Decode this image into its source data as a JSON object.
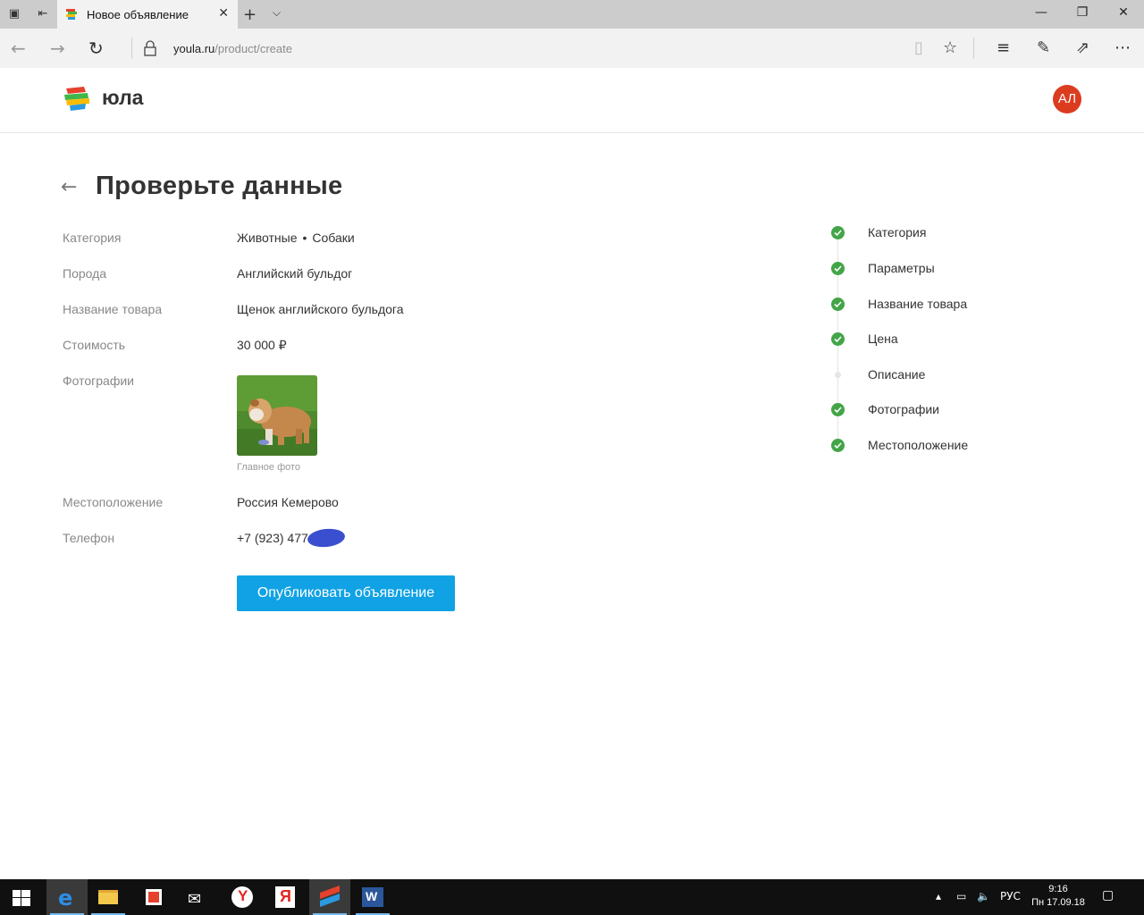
{
  "browser": {
    "tab_title": "Новое объявление",
    "url_host": "youla.ru",
    "url_path": "/product/create"
  },
  "site": {
    "logo_text": "юла",
    "avatar_initials": "АЛ"
  },
  "page": {
    "title": "Проверьте данные",
    "rows": {
      "category": {
        "label": "Категория",
        "value_main": "Животные",
        "value_sub": "Собаки"
      },
      "breed": {
        "label": "Порода",
        "value": "Английский бульдог"
      },
      "name": {
        "label": "Название товара",
        "value": "Щенок английского бульдога"
      },
      "price": {
        "label": "Стоимость",
        "value": "30 000 ₽"
      },
      "photos": {
        "label": "Фотографии",
        "caption": "Главное фото"
      },
      "location": {
        "label": "Местоположение",
        "value": "Россия Кемерово"
      },
      "phone": {
        "label": "Телефон",
        "value": "+7 (923) 477-"
      }
    },
    "publish_button": "Опубликовать объявление"
  },
  "steps": [
    {
      "label": "Категория",
      "done": true
    },
    {
      "label": "Параметры",
      "done": true
    },
    {
      "label": "Название товара",
      "done": true
    },
    {
      "label": "Цена",
      "done": true
    },
    {
      "label": "Описание",
      "done": false
    },
    {
      "label": "Фотографии",
      "done": true
    },
    {
      "label": "Местоположение",
      "done": true
    }
  ],
  "taskbar": {
    "language": "РУС",
    "time": "9:16",
    "date": "Пн 17.09.18"
  },
  "colors": {
    "accent": "#10a2e4",
    "step_done": "#43a548",
    "avatar": "#db3c20"
  }
}
